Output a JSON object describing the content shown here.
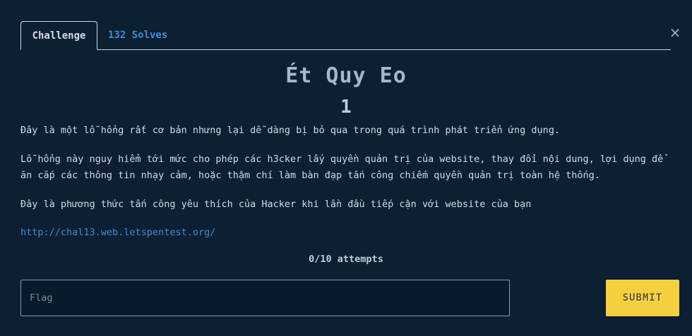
{
  "tabs": {
    "challenge_label": "Challenge",
    "solves_label": "132 Solves"
  },
  "close_icon": "×",
  "challenge": {
    "title": "Ét Quy Eo",
    "points": "1",
    "description": [
      "Đây là một lỗ hổng rất cơ bản nhưng lại dễ dàng bị bỏ qua trong quá trình phát triển ứng dụng.",
      "Lỗ hổng này nguy hiểm tới mức cho phép các h3cker lấy quyền quản trị của website, thay đổi nội dung, lợi dụng để ăn cắp các thông tin nhạy cảm, hoặc thậm chí làm bàn đạp tấn công chiếm quyền quản trị toàn hệ thống.",
      "Đây là phương thức tấn công yêu thích của Hacker khi lần đầu tiếp cận với website của bạn"
    ],
    "link": "http://chal13.web.letspentest.org/",
    "attempts": "0/10 attempts"
  },
  "form": {
    "flag_placeholder": "Flag",
    "flag_value": "",
    "submit_label": "SUBMIT"
  },
  "colors": {
    "background": "#0c1f33",
    "accent_link": "#3a8fd6",
    "submit_bg": "#f4d03f"
  }
}
